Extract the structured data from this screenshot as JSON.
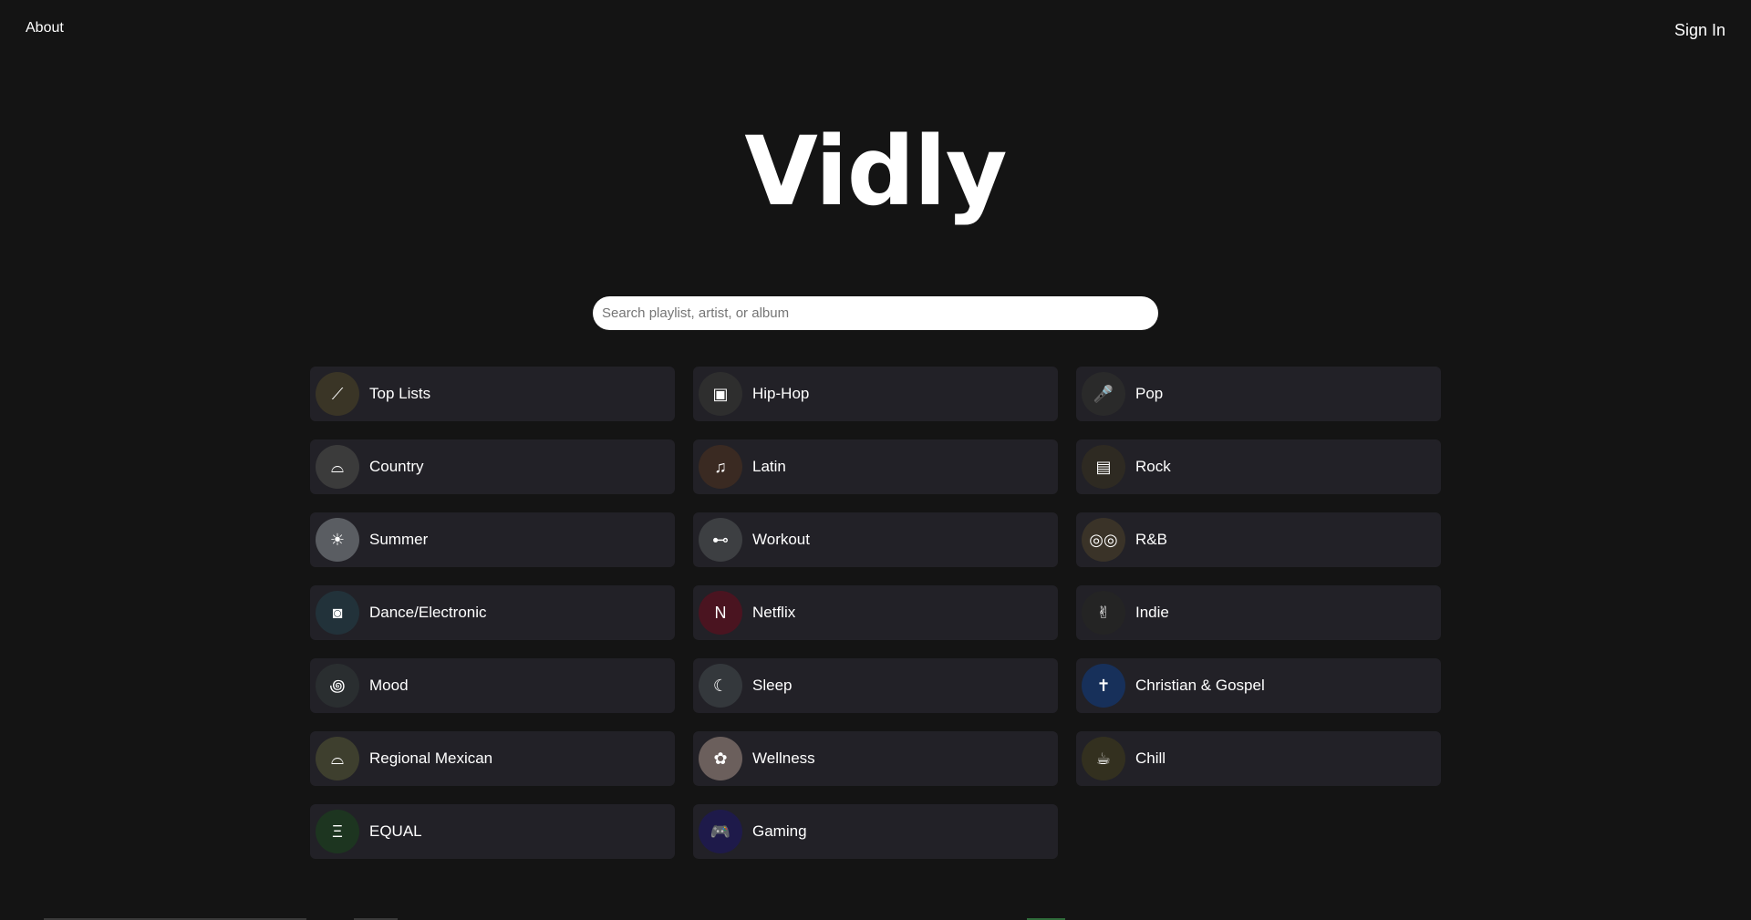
{
  "nav": {
    "about_label": "About",
    "signin_label": "Sign In"
  },
  "brand": {
    "logo_text": "Vidly"
  },
  "search": {
    "placeholder": "Search playlist, artist, or album",
    "value": ""
  },
  "categories": [
    {
      "label": "Top Lists",
      "icon": "chart-icon",
      "glyph": "⟋",
      "color": "#3a3526"
    },
    {
      "label": "Hip-Hop",
      "icon": "boombox-icon",
      "glyph": "▣",
      "color": "#2e2e2e"
    },
    {
      "label": "Pop",
      "icon": "microphone-icon",
      "glyph": "🎤",
      "color": "#2a2a2a"
    },
    {
      "label": "Country",
      "icon": "cowboy-hat-icon",
      "glyph": "⌓",
      "color": "#3b3b3b"
    },
    {
      "label": "Latin",
      "icon": "guitar-icon",
      "glyph": "♫",
      "color": "#3a2a22"
    },
    {
      "label": "Rock",
      "icon": "amplifier-icon",
      "glyph": "▤",
      "color": "#2e2a22"
    },
    {
      "label": "Summer",
      "icon": "sun-icon",
      "glyph": "☀",
      "color": "#5a5d62"
    },
    {
      "label": "Workout",
      "icon": "dumbbell-icon",
      "glyph": "⊷",
      "color": "#3d3f42"
    },
    {
      "label": "R&B",
      "icon": "glasses-icon",
      "glyph": "◎◎",
      "color": "#3a3328"
    },
    {
      "label": "Dance/Electronic",
      "icon": "headset-icon",
      "glyph": "◙",
      "color": "#22323a"
    },
    {
      "label": "Netflix",
      "icon": "netflix-icon",
      "glyph": "N",
      "color": "#4a1420"
    },
    {
      "label": "Indie",
      "icon": "rock-hand-icon",
      "glyph": "✌",
      "color": "#242424"
    },
    {
      "label": "Mood",
      "icon": "swirl-icon",
      "glyph": "꩜",
      "color": "#2a2e30"
    },
    {
      "label": "Sleep",
      "icon": "bed-icon",
      "glyph": "☾",
      "color": "#34383c"
    },
    {
      "label": "Christian & Gospel",
      "icon": "cross-icon",
      "glyph": "✝",
      "color": "#17305a"
    },
    {
      "label": "Regional Mexican",
      "icon": "sombrero-icon",
      "glyph": "⌓",
      "color": "#3e3f2e"
    },
    {
      "label": "Wellness",
      "icon": "lotus-hands-icon",
      "glyph": "✿",
      "color": "#6b5f5c"
    },
    {
      "label": "Chill",
      "icon": "cup-icon",
      "glyph": "☕",
      "color": "#33301f"
    },
    {
      "label": "EQUAL",
      "icon": "equal-logo-icon",
      "glyph": "Ξ",
      "color": "#1d3520"
    },
    {
      "label": "Gaming",
      "icon": "gamepad-icon",
      "glyph": "🎮",
      "color": "#1e1a4a"
    }
  ]
}
